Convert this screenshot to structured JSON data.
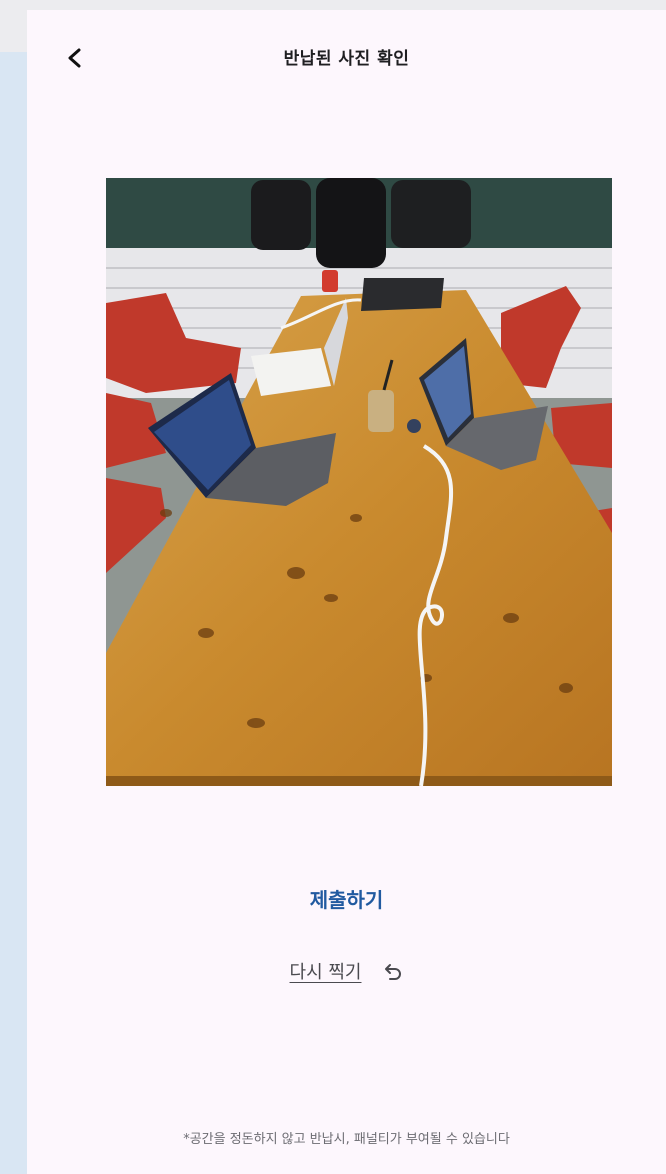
{
  "header": {
    "title": "반납된 사진 확인",
    "back_icon": "chevron-left-icon"
  },
  "actions": {
    "submit_label": "제출하기",
    "retake_label": "다시 찍기",
    "retake_icon": "undo-arrow-icon",
    "submit_color": "#215aa0"
  },
  "notice": "*공간을 정돈하지 않고 반납시, 패널티가 부여될 수 있습니다"
}
